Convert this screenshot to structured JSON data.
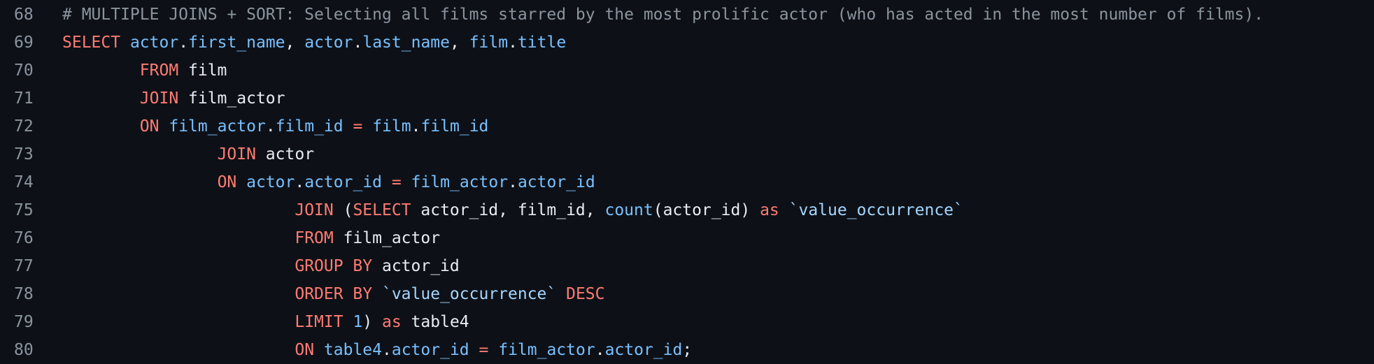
{
  "colors": {
    "background": "#0d1117",
    "line_number": "#8b949e",
    "comment": "#8b949e",
    "keyword": "#ff7b72",
    "identifier": "#79c0ff",
    "string": "#a5d6ff",
    "plain": "#e6edf3"
  },
  "lines": [
    {
      "number": "68",
      "tokens": [
        {
          "t": "comment",
          "v": "# MULTIPLE JOINS + SORT: Selecting all films starred by the most prolific actor (who has acted in the most number of films)."
        }
      ]
    },
    {
      "number": "69",
      "tokens": [
        {
          "t": "keyword",
          "v": "SELECT"
        },
        {
          "t": "plain",
          "v": " "
        },
        {
          "t": "ident",
          "v": "actor"
        },
        {
          "t": "plain",
          "v": "."
        },
        {
          "t": "ident",
          "v": "first_name"
        },
        {
          "t": "plain",
          "v": ", "
        },
        {
          "t": "ident",
          "v": "actor"
        },
        {
          "t": "plain",
          "v": "."
        },
        {
          "t": "ident",
          "v": "last_name"
        },
        {
          "t": "plain",
          "v": ", "
        },
        {
          "t": "ident",
          "v": "film"
        },
        {
          "t": "plain",
          "v": "."
        },
        {
          "t": "ident",
          "v": "title"
        }
      ]
    },
    {
      "number": "70",
      "tokens": [
        {
          "t": "plain",
          "v": "        "
        },
        {
          "t": "keyword",
          "v": "FROM"
        },
        {
          "t": "plain",
          "v": " film"
        }
      ]
    },
    {
      "number": "71",
      "tokens": [
        {
          "t": "plain",
          "v": "        "
        },
        {
          "t": "keyword",
          "v": "JOIN"
        },
        {
          "t": "plain",
          "v": " film_actor"
        }
      ]
    },
    {
      "number": "72",
      "tokens": [
        {
          "t": "plain",
          "v": "        "
        },
        {
          "t": "keyword",
          "v": "ON"
        },
        {
          "t": "plain",
          "v": " "
        },
        {
          "t": "ident",
          "v": "film_actor"
        },
        {
          "t": "plain",
          "v": "."
        },
        {
          "t": "ident",
          "v": "film_id"
        },
        {
          "t": "plain",
          "v": " "
        },
        {
          "t": "keyword",
          "v": "="
        },
        {
          "t": "plain",
          "v": " "
        },
        {
          "t": "ident",
          "v": "film"
        },
        {
          "t": "plain",
          "v": "."
        },
        {
          "t": "ident",
          "v": "film_id"
        }
      ]
    },
    {
      "number": "73",
      "tokens": [
        {
          "t": "plain",
          "v": "                "
        },
        {
          "t": "keyword",
          "v": "JOIN"
        },
        {
          "t": "plain",
          "v": " actor"
        }
      ]
    },
    {
      "number": "74",
      "tokens": [
        {
          "t": "plain",
          "v": "                "
        },
        {
          "t": "keyword",
          "v": "ON"
        },
        {
          "t": "plain",
          "v": " "
        },
        {
          "t": "ident",
          "v": "actor"
        },
        {
          "t": "plain",
          "v": "."
        },
        {
          "t": "ident",
          "v": "actor_id"
        },
        {
          "t": "plain",
          "v": " "
        },
        {
          "t": "keyword",
          "v": "="
        },
        {
          "t": "plain",
          "v": " "
        },
        {
          "t": "ident",
          "v": "film_actor"
        },
        {
          "t": "plain",
          "v": "."
        },
        {
          "t": "ident",
          "v": "actor_id"
        }
      ]
    },
    {
      "number": "75",
      "tokens": [
        {
          "t": "plain",
          "v": "                        "
        },
        {
          "t": "keyword",
          "v": "JOIN"
        },
        {
          "t": "plain",
          "v": " ("
        },
        {
          "t": "keyword",
          "v": "SELECT"
        },
        {
          "t": "plain",
          "v": " actor_id, film_id, "
        },
        {
          "t": "ident",
          "v": "count"
        },
        {
          "t": "plain",
          "v": "(actor_id) "
        },
        {
          "t": "keyword",
          "v": "as"
        },
        {
          "t": "plain",
          "v": " "
        },
        {
          "t": "string",
          "v": "`value_occurrence`"
        }
      ]
    },
    {
      "number": "76",
      "tokens": [
        {
          "t": "plain",
          "v": "                        "
        },
        {
          "t": "keyword",
          "v": "FROM"
        },
        {
          "t": "plain",
          "v": " film_actor"
        }
      ]
    },
    {
      "number": "77",
      "tokens": [
        {
          "t": "plain",
          "v": "                        "
        },
        {
          "t": "keyword",
          "v": "GROUP BY"
        },
        {
          "t": "plain",
          "v": " actor_id"
        }
      ]
    },
    {
      "number": "78",
      "tokens": [
        {
          "t": "plain",
          "v": "                        "
        },
        {
          "t": "keyword",
          "v": "ORDER BY"
        },
        {
          "t": "plain",
          "v": " "
        },
        {
          "t": "string",
          "v": "`value_occurrence`"
        },
        {
          "t": "plain",
          "v": " "
        },
        {
          "t": "keyword",
          "v": "DESC"
        }
      ]
    },
    {
      "number": "79",
      "tokens": [
        {
          "t": "plain",
          "v": "                        "
        },
        {
          "t": "keyword",
          "v": "LIMIT"
        },
        {
          "t": "plain",
          "v": " "
        },
        {
          "t": "ident",
          "v": "1"
        },
        {
          "t": "plain",
          "v": ") "
        },
        {
          "t": "keyword",
          "v": "as"
        },
        {
          "t": "plain",
          "v": " table4"
        }
      ]
    },
    {
      "number": "80",
      "tokens": [
        {
          "t": "plain",
          "v": "                        "
        },
        {
          "t": "keyword",
          "v": "ON"
        },
        {
          "t": "plain",
          "v": " "
        },
        {
          "t": "ident",
          "v": "table4"
        },
        {
          "t": "plain",
          "v": "."
        },
        {
          "t": "ident",
          "v": "actor_id"
        },
        {
          "t": "plain",
          "v": " "
        },
        {
          "t": "keyword",
          "v": "="
        },
        {
          "t": "plain",
          "v": " "
        },
        {
          "t": "ident",
          "v": "film_actor"
        },
        {
          "t": "plain",
          "v": "."
        },
        {
          "t": "ident",
          "v": "actor_id"
        },
        {
          "t": "plain",
          "v": ";"
        }
      ]
    }
  ]
}
